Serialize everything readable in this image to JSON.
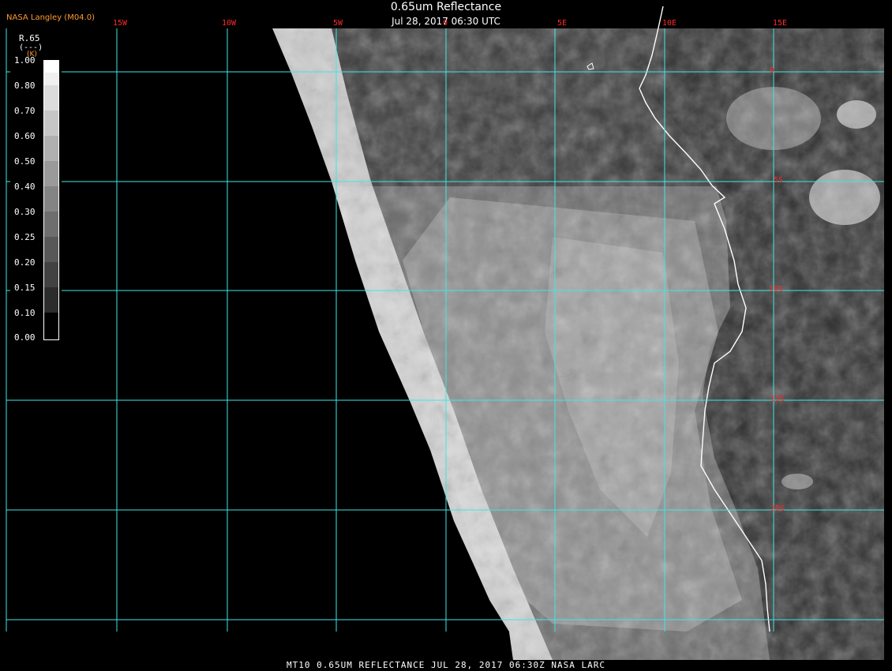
{
  "header": {
    "credit": "NASA Langley (M04.0)",
    "title": "0.65um Reflectance",
    "subtitle": "Jul 28, 2017 06:30 UTC"
  },
  "legend": {
    "variable": "R.65",
    "units": "(---)",
    "k_label": "(K)",
    "ticks": [
      "1.00",
      "0.80",
      "0.70",
      "0.60",
      "0.50",
      "0.40",
      "0.30",
      "0.25",
      "0.20",
      "0.15",
      "0.10",
      "0.00"
    ]
  },
  "grid": {
    "longitude_labels": [
      "15W",
      "10W",
      "5W",
      "0",
      "5E",
      "10E",
      "15E"
    ],
    "latitude_labels": [
      "0",
      "5S",
      "10S",
      "15S",
      "20S"
    ],
    "grid_color": "#3fe6e6",
    "label_color": "#ff2a2a"
  },
  "colors": {
    "coastline": "#ffffff",
    "credit": "#ff9b2e",
    "background": "#000000"
  },
  "footer": {
    "caption": "MT10  0.65UM REFLECTANCE   JUL 28, 2017 06:30Z   NASA LARC"
  }
}
